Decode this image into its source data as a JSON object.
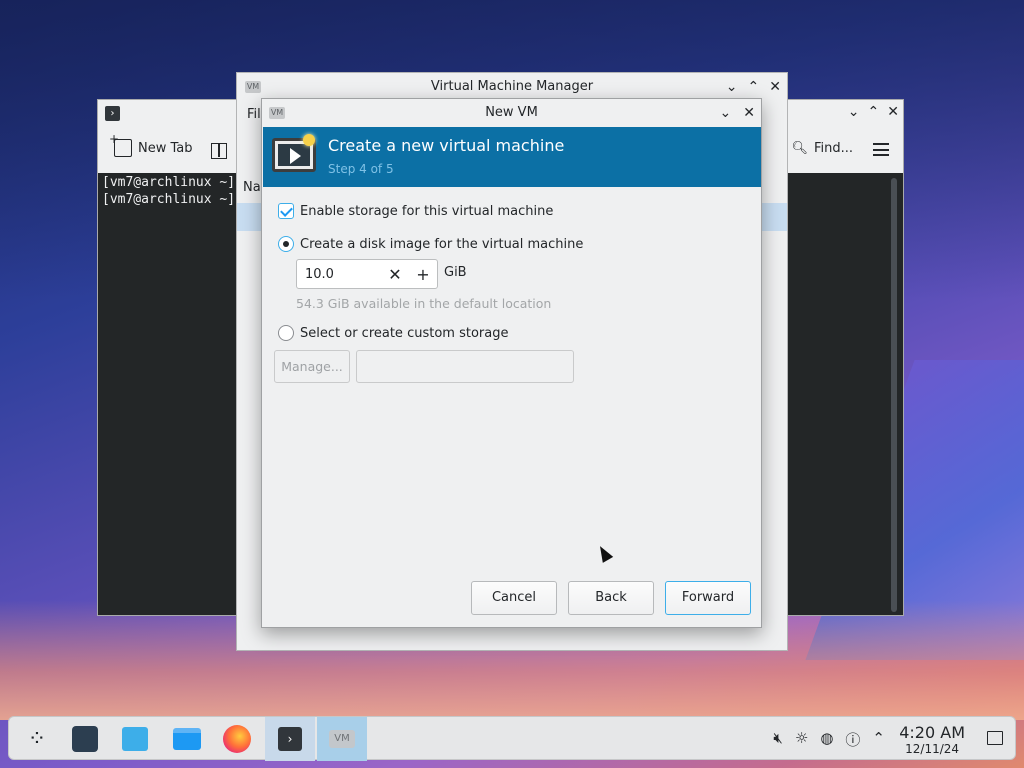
{
  "desktop": {
    "terminal": {
      "new_tab_label": "New Tab",
      "find_label": "Find...",
      "lines": [
        "[vm7@archlinux ~]",
        "[vm7@archlinux ~]"
      ]
    },
    "vmm": {
      "title": "Virtual Machine Manager",
      "menu_partial": "Fil",
      "column_partial": "Na"
    }
  },
  "dialog": {
    "window_title": "New VM",
    "header": {
      "title": "Create a new virtual machine",
      "step": "Step 4 of 5"
    },
    "enable_storage_label": "Enable storage for this virtual machine",
    "enable_storage_checked": true,
    "option_disk_image_label": "Create a disk image for the virtual machine",
    "disk_size_value": "10.0",
    "disk_size_unit": "GiB",
    "available_hint": "54.3 GiB available in the default location",
    "option_custom_label": "Select or create custom storage",
    "manage_label": "Manage...",
    "custom_path_value": "",
    "buttons": {
      "cancel": "Cancel",
      "back": "Back",
      "forward": "Forward"
    }
  },
  "taskbar": {
    "clock_time": "4:20 AM",
    "clock_date": "12/11/24"
  },
  "icons": {
    "launcher": "launcher-icon",
    "settings": "system-settings-icon",
    "store": "discover-store-icon",
    "files": "file-manager-icon",
    "firefox": "firefox-icon",
    "terminal": "terminal-icon",
    "vm": "virt-manager-icon"
  },
  "colors": {
    "header_bg": "#0c70a5",
    "accent": "#3daee9",
    "step_text": "#7fc1e6"
  }
}
